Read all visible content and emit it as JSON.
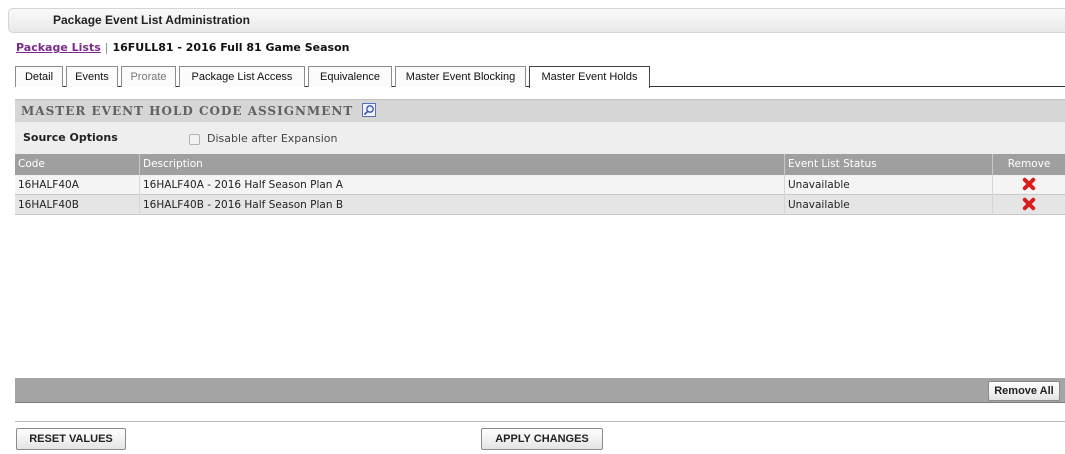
{
  "window": {
    "title": "Package Event List Administration"
  },
  "breadcrumb": {
    "link": "Package Lists",
    "separator": "|",
    "current": "16FULL81 - 2016 Full 81 Game Season"
  },
  "tabs": [
    {
      "label": "Detail"
    },
    {
      "label": "Events"
    },
    {
      "label": "Prorate"
    },
    {
      "label": "Package List Access"
    },
    {
      "label": "Equivalence"
    },
    {
      "label": "Master Event Blocking"
    },
    {
      "label": "Master Event Holds"
    }
  ],
  "section": {
    "title": "MASTER EVENT HOLD CODE ASSIGNMENT",
    "icon": "magnifier-icon"
  },
  "source_options": {
    "label": "Source Options",
    "checkbox_label": "Disable after Expansion",
    "checked": false
  },
  "grid": {
    "columns": [
      "Code",
      "Description",
      "Event List Status",
      "Remove"
    ],
    "rows": [
      {
        "code": "16HALF40A",
        "description": "16HALF40A - 2016 Half Season Plan A",
        "status": "Unavailable"
      },
      {
        "code": "16HALF40B",
        "description": "16HALF40B - 2016 Half Season Plan B",
        "status": "Unavailable"
      }
    ],
    "remove_all_label": "Remove All"
  },
  "actions": {
    "reset_label": "RESET VALUES",
    "apply_label": "APPLY CHANGES"
  },
  "colors": {
    "link": "#7b2a8b",
    "remove_icon": "#d81f1f",
    "header_bg": "#9f9f9f"
  }
}
